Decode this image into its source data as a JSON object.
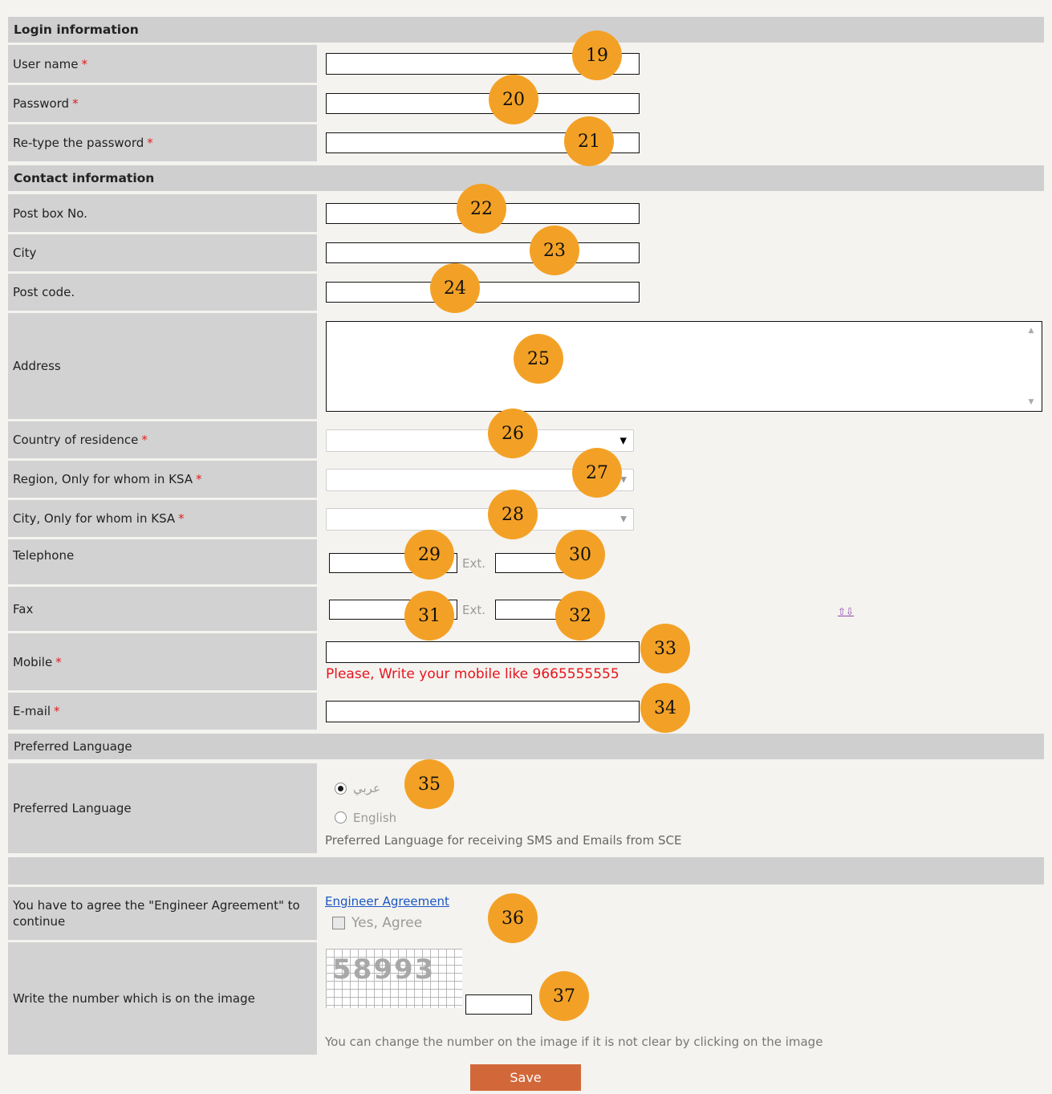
{
  "sections": {
    "login": "Login information",
    "contact": "Contact information",
    "pref": "Preferred Language"
  },
  "required_mark": "*",
  "fields": {
    "username": "User name",
    "password": "Password",
    "retype": "Re-type the password",
    "postbox": "Post box No.",
    "city": "City",
    "postcode": "Post code.",
    "address": "Address",
    "country": "Country of residence",
    "region": "Region, Only for whom in KSA",
    "city_ksa": "City, Only for whom in KSA",
    "telephone": "Telephone",
    "fax": "Fax",
    "mobile": "Mobile",
    "email": "E-mail",
    "pref_lang": "Preferred Language",
    "agreement": "You have to agree the \"Engineer Agreement\" to continue",
    "captcha": "Write the number which is on the image"
  },
  "ext_label": "Ext.",
  "mobile_hint": "Please, Write your mobile like 9665555555",
  "language": {
    "arabic": "عربي",
    "english": "English",
    "hint": "Preferred Language for receiving SMS and Emails from SCE",
    "selected": "arabic"
  },
  "agreement_link": "Engineer Agreement",
  "agree_checkbox": "Yes, Agree",
  "captcha_value": "58993",
  "captcha_hint": "You can change the number on the image if it is not clear by clicking on the image",
  "save_button": "Save",
  "sort_arrows": "⇧⇩",
  "badges": [
    "19",
    "20",
    "21",
    "22",
    "23",
    "24",
    "25",
    "26",
    "27",
    "28",
    "29",
    "30",
    "31",
    "32",
    "33",
    "34",
    "35",
    "36",
    "37"
  ],
  "colors": {
    "badge": "#f3a126",
    "required": "#e02020",
    "save": "#d2683a",
    "hint_red": "#e8141e",
    "link": "#1a56c4"
  }
}
